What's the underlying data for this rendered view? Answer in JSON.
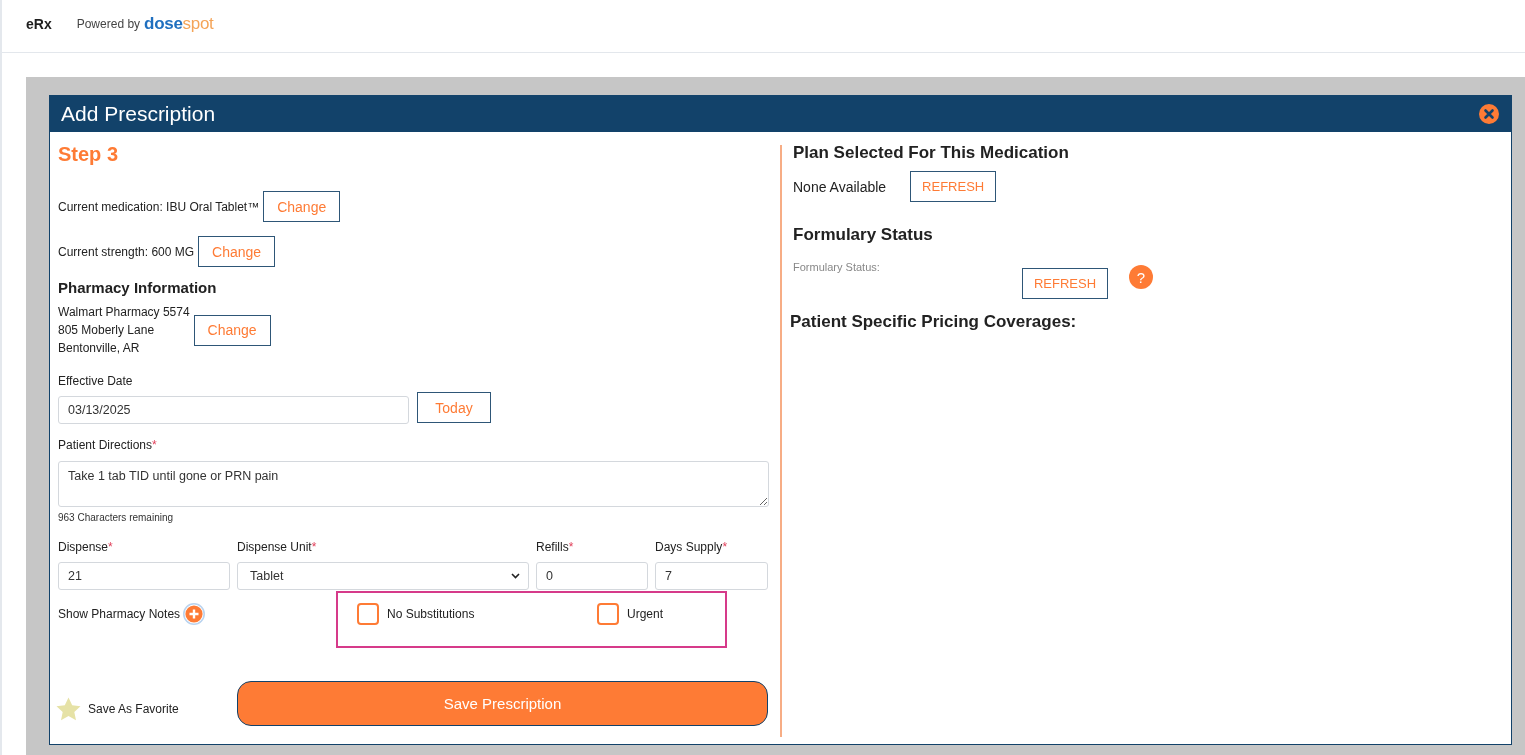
{
  "header": {
    "app_name": "eRx",
    "powered_by": "Powered by",
    "logo_parts": [
      "dose",
      "spot"
    ]
  },
  "dialog": {
    "title": "Add Prescription",
    "step": "Step 3",
    "medication": {
      "text": "Current medication: IBU Oral Tablet™",
      "button": "Change"
    },
    "strength": {
      "text": "Current strength: 600 MG",
      "button": "Change"
    },
    "pharmacy": {
      "heading": "Pharmacy Information",
      "lines": [
        "Walmart Pharmacy 5574",
        "805 Moberly Lane",
        "Bentonville, AR"
      ],
      "button": "Change"
    },
    "effective_date": {
      "label": "Effective Date",
      "value": "03/13/2025",
      "button": "Today"
    },
    "directions": {
      "label": "Patient Directions",
      "required_mark": "*",
      "value": "Take 1 tab TID until gone or PRN pain",
      "counter": "963 Characters remaining"
    },
    "dispense_fields": [
      {
        "label": "Dispense",
        "required_mark": "*",
        "value": "21",
        "kind": "input"
      },
      {
        "label": "Dispense Unit",
        "required_mark": "*",
        "value": "Tablet",
        "kind": "select"
      },
      {
        "label": "Refills",
        "required_mark": "*",
        "value": "0",
        "kind": "input"
      },
      {
        "label": "Days Supply",
        "required_mark": "*",
        "value": "7",
        "kind": "input"
      }
    ],
    "pharmacy_notes": {
      "label": "Show Pharmacy Notes"
    },
    "substitution_options": {
      "highlighted": true,
      "items": [
        {
          "label": "No Substitutions",
          "checked": false
        },
        {
          "label": "Urgent",
          "checked": false
        }
      ]
    },
    "favorite": {
      "label": "Save As Favorite",
      "on": false
    },
    "save_button": "Save Prescription",
    "plan": {
      "heading": "Plan Selected For This Medication",
      "value": "None Available",
      "button": "REFRESH"
    },
    "formulary": {
      "heading": "Formulary Status",
      "label": "Formulary Status:",
      "button": "REFRESH",
      "help": "?"
    },
    "pricing": {
      "heading": "Patient Specific Pricing Coverages:"
    }
  }
}
